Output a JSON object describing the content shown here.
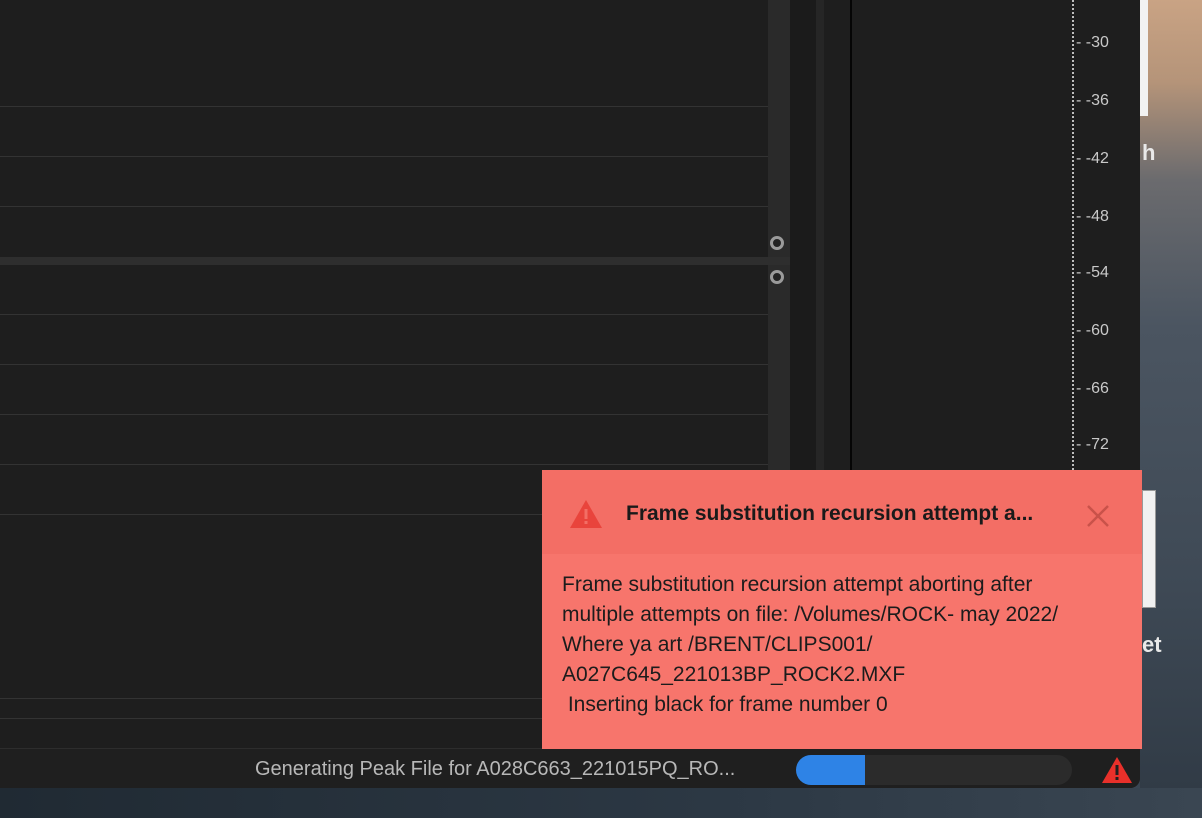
{
  "meter": {
    "labels": [
      "- -30",
      "- -36",
      "- -42",
      "- -48",
      "- -54",
      "- -60",
      "- -66",
      "- -72"
    ]
  },
  "status": {
    "text": "Generating Peak File for A028C663_221015PQ_RO...",
    "progress_fraction": 0.25
  },
  "toast": {
    "title": "Frame substitution recursion attempt a...",
    "body_lines": [
      "Frame substitution recursion attempt aborting after",
      "multiple attempts on file: /Volumes/ROCK- may 2022/",
      "Where ya art /BRENT/CLIPS001/",
      "A027C645_221013BP_ROCK2.MXF",
      " Inserting black for frame number 0"
    ]
  },
  "desktop": {
    "fragment_1": "h",
    "fragment_2": "et"
  },
  "colors": {
    "toast_bg": "#f7756c",
    "progress_fill": "#2e83e6",
    "warning": "#e8302a"
  }
}
